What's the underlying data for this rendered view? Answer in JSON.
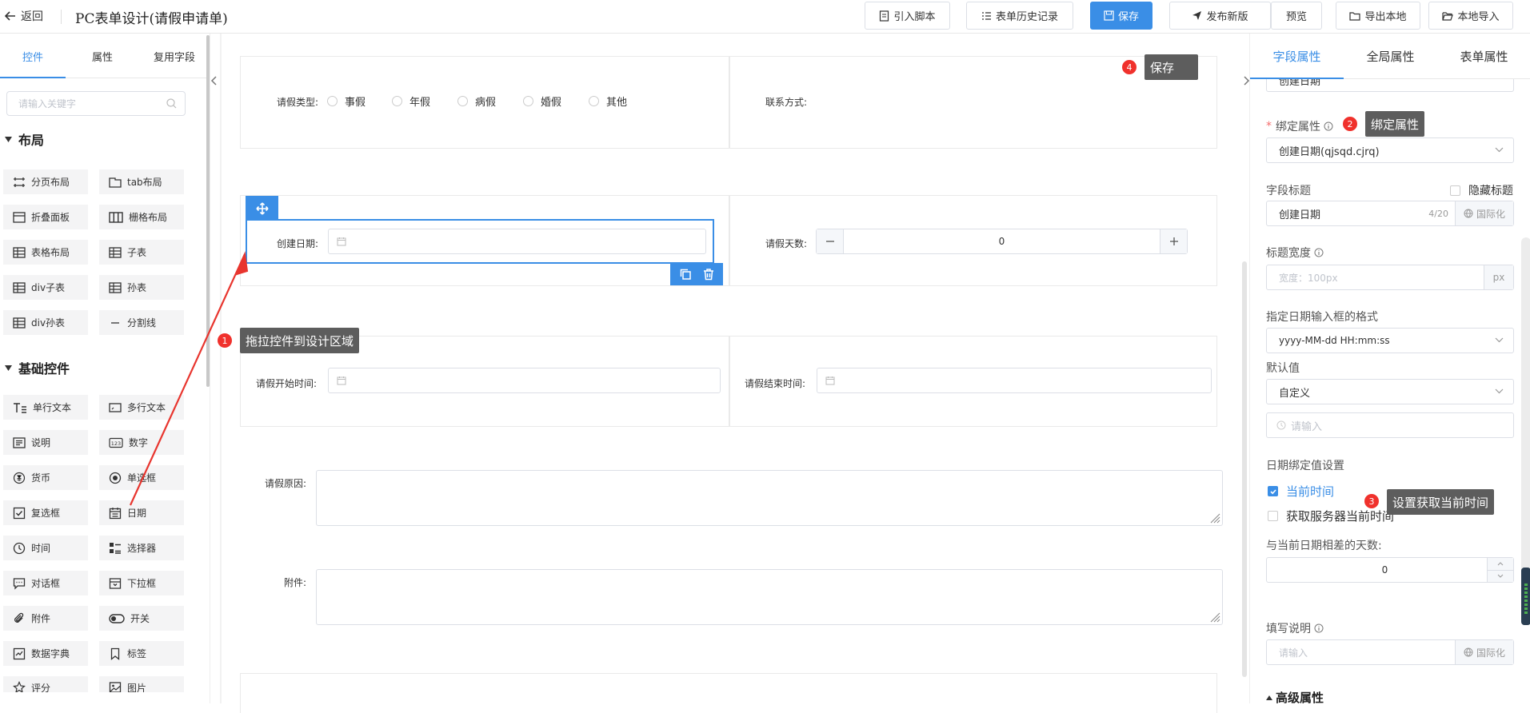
{
  "header": {
    "back_label": "返回",
    "title": "PC表单设计(请假申请单)",
    "buttons": {
      "import_script": "引入脚本",
      "history": "表单历史记录",
      "save": "保存",
      "publish": "发布新版",
      "preview": "预览",
      "export_local": "导出本地",
      "import_local": "本地导入"
    }
  },
  "left_panel": {
    "tabs": [
      "控件",
      "属性",
      "复用字段"
    ],
    "active_tab": "控件",
    "search_placeholder": "请输入关键字",
    "layout_section": "布局",
    "layout_items": [
      "分页布局",
      "tab布局",
      "折叠面板",
      "栅格布局",
      "表格布局",
      "子表",
      "div子表",
      "孙表",
      "div孙表",
      "分割线"
    ],
    "basic_section": "基础控件",
    "basic_items": [
      "单行文本",
      "多行文本",
      "说明",
      "数字",
      "货币",
      "单选框",
      "复选框",
      "日期",
      "时间",
      "选择器",
      "对话框",
      "下拉框",
      "附件",
      "开关",
      "数据字典",
      "标签",
      "评分",
      "图片"
    ]
  },
  "canvas": {
    "leave_type_label": "请假类型:",
    "leave_type_options": [
      "事假",
      "年假",
      "病假",
      "婚假",
      "其他"
    ],
    "contact_label": "联系方式:",
    "create_date_label": "创建日期:",
    "leave_days_label": "请假天数:",
    "leave_days_value": "0",
    "start_time_label": "请假开始时间:",
    "end_time_label": "请假结束时间:",
    "reason_label": "请假原因:",
    "attachment_label": "附件:"
  },
  "annotations": [
    {
      "number": "1",
      "text": "拖拉控件到设计区域"
    },
    {
      "number": "2",
      "text": "绑定属性"
    },
    {
      "number": "3",
      "text": "设置获取当前时间"
    },
    {
      "number": "4",
      "text": "保存"
    }
  ],
  "right_panel": {
    "tabs": [
      "字段属性",
      "全局属性",
      "表单属性"
    ],
    "active_tab": "字段属性",
    "top_cut_select": "创建日期",
    "bind_label": "绑定属性",
    "bind_value": "创建日期(qjsqd.cjrq)",
    "field_title_label": "字段标题",
    "hide_title_label": "隐藏标题",
    "field_title_value": "创建日期",
    "field_title_count": "4/20",
    "i18n_label": "国际化",
    "title_width_label": "标题宽度",
    "title_width_placeholder": "宽度：100px",
    "title_width_unit": "px",
    "date_format_label": "指定日期输入框的格式",
    "date_format_value": "yyyy-MM-dd HH:mm:ss",
    "default_label": "默认值",
    "default_value": "自定义",
    "default_input_placeholder": "请输入",
    "date_bind_label": "日期绑定值设置",
    "current_time_label": "当前时间",
    "current_time_checked": true,
    "server_time_label": "获取服务器当前时间",
    "server_time_checked": false,
    "diff_days_label": "与当前日期相差的天数:",
    "diff_days_value": "0",
    "fill_desc_label": "填写说明",
    "fill_desc_placeholder": "请输入",
    "advanced_label": "高级属性"
  },
  "colors": {
    "accent": "#3a8ee6",
    "badge": "#f0312c",
    "tip_bg": "#5d5d5d",
    "arrow": "#e8352e"
  }
}
